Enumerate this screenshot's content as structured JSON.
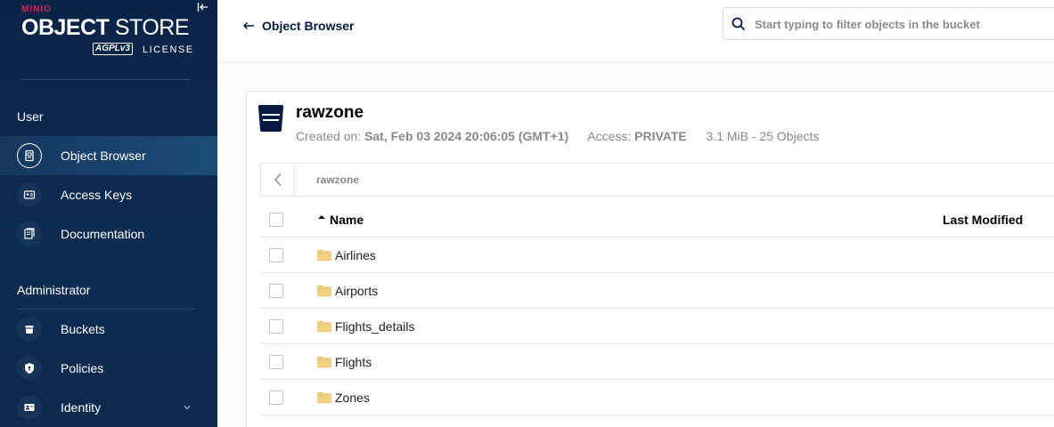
{
  "sidebar": {
    "logo": {
      "brand": "MINIO",
      "title_bold": "OBJECT",
      "title_thin": " STORE",
      "agpl": "AGPLv3",
      "license": "LICENSE"
    },
    "sections": [
      {
        "label": "User",
        "items": [
          {
            "label": "Object Browser",
            "icon": "object-browser-icon",
            "active": true
          },
          {
            "label": "Access Keys",
            "icon": "access-keys-icon"
          },
          {
            "label": "Documentation",
            "icon": "documentation-icon"
          }
        ]
      },
      {
        "label": "Administrator",
        "items": [
          {
            "label": "Buckets",
            "icon": "buckets-icon"
          },
          {
            "label": "Policies",
            "icon": "policies-icon"
          },
          {
            "label": "Identity",
            "icon": "identity-icon",
            "expandable": true
          }
        ]
      }
    ]
  },
  "header": {
    "back_label": "Object Browser",
    "search_placeholder": "Start typing to filter objects in the bucket"
  },
  "bucket": {
    "name": "rawzone",
    "created_label": "Created on:",
    "created_value": "Sat, Feb 03 2024 20:06:05 (GMT+1)",
    "access_label": "Access:",
    "access_value": "PRIVATE",
    "size_summary": "3.1 MiB - 25 Objects"
  },
  "breadcrumb": {
    "path": "rawzone"
  },
  "table": {
    "columns": {
      "name": "Name",
      "last_modified": "Last Modified"
    },
    "sort": {
      "column": "Name",
      "direction": "ascending"
    },
    "rows": [
      {
        "name": "Airlines",
        "type": "folder"
      },
      {
        "name": "Airports",
        "type": "folder"
      },
      {
        "name": "Flights_details",
        "type": "folder"
      },
      {
        "name": "Flights",
        "type": "folder"
      },
      {
        "name": "Zones",
        "type": "folder"
      }
    ]
  },
  "colors": {
    "sidebar_bg": "#0a2447",
    "brand_red": "#c72c48",
    "folder": "#f2d184",
    "text_dark": "#07193e"
  }
}
